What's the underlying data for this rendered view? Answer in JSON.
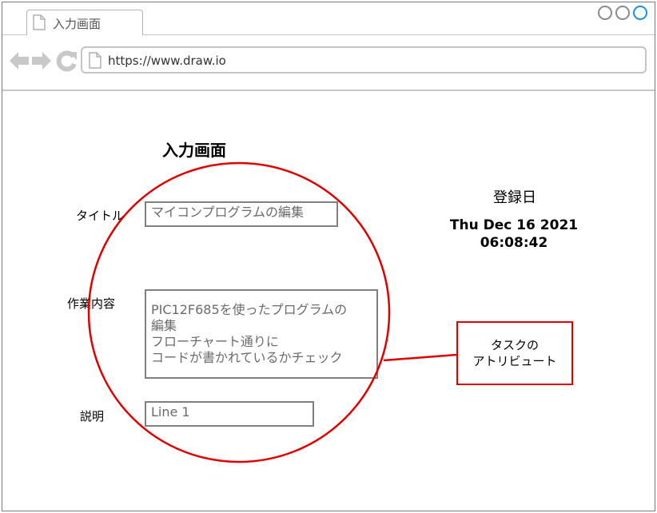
{
  "browser": {
    "tab_title": "入力画面",
    "url": "https://www.draw.io"
  },
  "form": {
    "heading": "入力画面",
    "title_label": "タイトル",
    "title_value": "マイコンプログラムの編集",
    "work_label": "作業内容",
    "work_value": "PIC12F685を使ったプログラムの\n編集\nフローチャート通りに\nコードが書かれているかチェック",
    "desc_label": "説明",
    "desc_value": "Line 1"
  },
  "registration": {
    "label": "登録日",
    "date": "Thu Dec 16 2021\n06:08:42"
  },
  "annotation": {
    "callout_text": "タスクの\nアトリビュート",
    "color": "#e00000"
  }
}
